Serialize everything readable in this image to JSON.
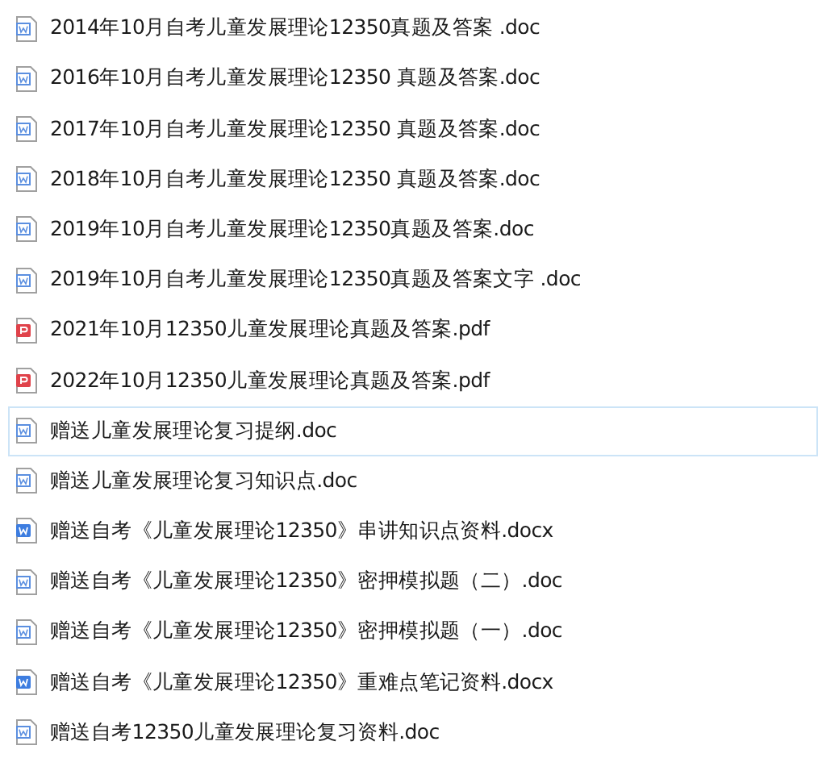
{
  "files": [
    {
      "name": "2014年10月自考儿童发展理论12350真题及答案 .doc",
      "kind": "doc",
      "selected": false
    },
    {
      "name": "2016年10月自考儿童发展理论12350 真题及答案.doc",
      "kind": "doc",
      "selected": false
    },
    {
      "name": "2017年10月自考儿童发展理论12350 真题及答案.doc",
      "kind": "doc",
      "selected": false
    },
    {
      "name": "2018年10月自考儿童发展理论12350 真题及答案.doc",
      "kind": "doc",
      "selected": false
    },
    {
      "name": "2019年10月自考儿童发展理论12350真题及答案.doc",
      "kind": "doc",
      "selected": false
    },
    {
      "name": "2019年10月自考儿童发展理论12350真题及答案文字 .doc",
      "kind": "doc",
      "selected": false
    },
    {
      "name": "2021年10月12350儿童发展理论真题及答案.pdf",
      "kind": "pdf",
      "selected": false
    },
    {
      "name": "2022年10月12350儿童发展理论真题及答案.pdf",
      "kind": "pdf",
      "selected": false
    },
    {
      "name": "赠送儿童发展理论复习提纲.doc",
      "kind": "doc",
      "selected": true
    },
    {
      "name": "赠送儿童发展理论复习知识点.doc",
      "kind": "doc",
      "selected": false
    },
    {
      "name": "赠送自考《儿童发展理论12350》串讲知识点资料.docx",
      "kind": "docx",
      "selected": false
    },
    {
      "name": "赠送自考《儿童发展理论12350》密押模拟题（二）.doc",
      "kind": "doc",
      "selected": false
    },
    {
      "name": "赠送自考《儿童发展理论12350》密押模拟题（一）.doc",
      "kind": "doc",
      "selected": false
    },
    {
      "name": "赠送自考《儿童发展理论12350》重难点笔记资料.docx",
      "kind": "docx",
      "selected": false
    },
    {
      "name": "赠送自考12350儿童发展理论复习资料.doc",
      "kind": "doc",
      "selected": false
    }
  ]
}
